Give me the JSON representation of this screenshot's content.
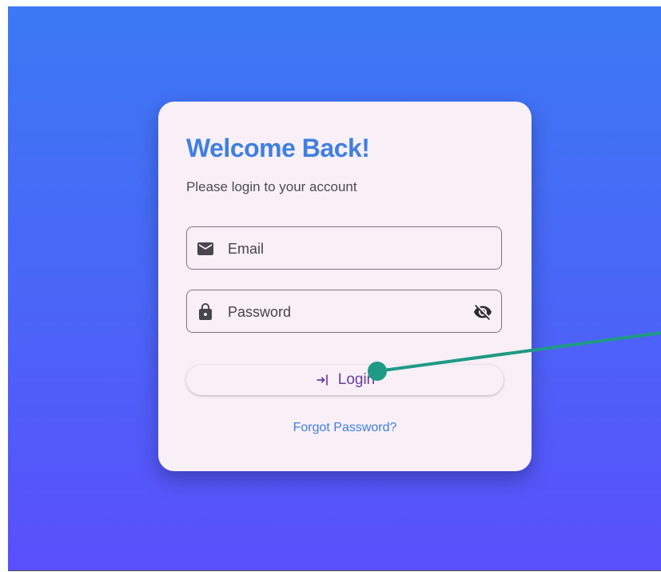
{
  "colors": {
    "background_top": "#3c79f4",
    "background_bottom": "#5a4ffb",
    "card": "#f8eff7",
    "title": "#3f7fe0",
    "button_text": "#6a3d9e",
    "link": "#3f7fe0",
    "pointer": "#1f9a84"
  },
  "login_card": {
    "title": "Welcome Back!",
    "subtitle": "Please login to your account",
    "email_field": {
      "icon": "mail-icon",
      "placeholder": "Email"
    },
    "password_field": {
      "icon": "lock-icon",
      "placeholder": "Password",
      "toggle_icon": "visibility-off-icon"
    },
    "login_button": {
      "icon": "login-icon",
      "label": "Login"
    },
    "forgot_password_link": "Forgot Password?"
  }
}
